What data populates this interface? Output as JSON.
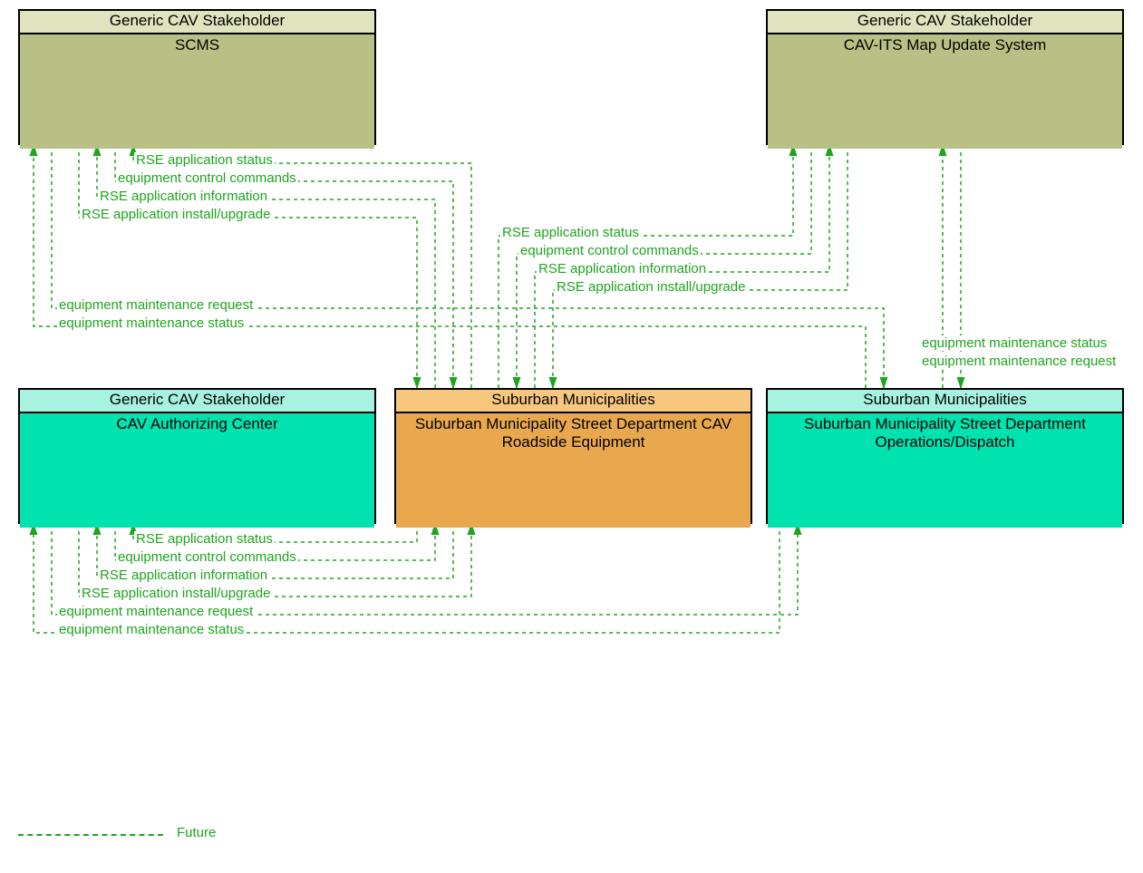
{
  "boxes": {
    "scms": {
      "header": "Generic CAV Stakeholder",
      "title": "SCMS"
    },
    "mapupdate": {
      "header": "Generic CAV Stakeholder",
      "title": "CAV-ITS Map Update System"
    },
    "authcenter": {
      "header": "Generic CAV Stakeholder",
      "title": "CAV Authorizing Center"
    },
    "roadside": {
      "header": "Suburban Municipalities",
      "title": "Suburban Municipality Street Department CAV Roadside Equipment"
    },
    "dispatch": {
      "header": "Suburban Municipalities",
      "title": "Suburban Municipality Street Department Operations/Dispatch"
    }
  },
  "flows": {
    "set1": {
      "a": "RSE application status",
      "b": "equipment control commands",
      "c": "RSE application information",
      "d": "RSE application install/upgrade",
      "e": "equipment maintenance request",
      "f": "equipment maintenance status"
    },
    "set2": {
      "a": "RSE application status",
      "b": "equipment control commands",
      "c": "RSE application information",
      "d": "RSE application install/upgrade",
      "e": "equipment maintenance status",
      "f": "equipment maintenance request"
    },
    "set3": {
      "a": "RSE application status",
      "b": "equipment control commands",
      "c": "RSE application information",
      "d": "RSE application install/upgrade",
      "e": "equipment maintenance request",
      "f": "equipment maintenance status"
    }
  },
  "legend": "Future",
  "chart_data": {
    "type": "diagram",
    "nodes": [
      {
        "id": "scms",
        "stakeholder": "Generic CAV Stakeholder",
        "name": "SCMS",
        "color": "olive"
      },
      {
        "id": "mapupdate",
        "stakeholder": "Generic CAV Stakeholder",
        "name": "CAV-ITS Map Update System",
        "color": "olive"
      },
      {
        "id": "authcenter",
        "stakeholder": "Generic CAV Stakeholder",
        "name": "CAV Authorizing Center",
        "color": "teal"
      },
      {
        "id": "roadside",
        "stakeholder": "Suburban Municipalities",
        "name": "Suburban Municipality Street Department CAV Roadside Equipment",
        "color": "orange"
      },
      {
        "id": "dispatch",
        "stakeholder": "Suburban Municipalities",
        "name": "Suburban Municipality Street Department Operations/Dispatch",
        "color": "teal"
      }
    ],
    "edges": [
      {
        "from": "roadside",
        "to": "scms",
        "label": "RSE application status",
        "status": "Future"
      },
      {
        "from": "scms",
        "to": "roadside",
        "label": "equipment control commands",
        "status": "Future"
      },
      {
        "from": "roadside",
        "to": "scms",
        "label": "RSE application information",
        "status": "Future"
      },
      {
        "from": "scms",
        "to": "roadside",
        "label": "RSE application install/upgrade",
        "status": "Future"
      },
      {
        "from": "scms",
        "to": "dispatch",
        "label": "equipment maintenance request",
        "status": "Future"
      },
      {
        "from": "dispatch",
        "to": "scms",
        "label": "equipment maintenance status",
        "status": "Future"
      },
      {
        "from": "roadside",
        "to": "mapupdate",
        "label": "RSE application status",
        "status": "Future"
      },
      {
        "from": "mapupdate",
        "to": "roadside",
        "label": "equipment control commands",
        "status": "Future"
      },
      {
        "from": "roadside",
        "to": "mapupdate",
        "label": "RSE application information",
        "status": "Future"
      },
      {
        "from": "mapupdate",
        "to": "roadside",
        "label": "RSE application install/upgrade",
        "status": "Future"
      },
      {
        "from": "dispatch",
        "to": "mapupdate",
        "label": "equipment maintenance status",
        "status": "Future"
      },
      {
        "from": "mapupdate",
        "to": "dispatch",
        "label": "equipment maintenance request",
        "status": "Future"
      },
      {
        "from": "roadside",
        "to": "authcenter",
        "label": "RSE application status",
        "status": "Future"
      },
      {
        "from": "authcenter",
        "to": "roadside",
        "label": "equipment control commands",
        "status": "Future"
      },
      {
        "from": "roadside",
        "to": "authcenter",
        "label": "RSE application information",
        "status": "Future"
      },
      {
        "from": "authcenter",
        "to": "roadside",
        "label": "RSE application install/upgrade",
        "status": "Future"
      },
      {
        "from": "authcenter",
        "to": "dispatch",
        "label": "equipment maintenance request",
        "status": "Future"
      },
      {
        "from": "dispatch",
        "to": "authcenter",
        "label": "equipment maintenance status",
        "status": "Future"
      }
    ],
    "legend": [
      {
        "style": "dashed-green",
        "label": "Future"
      }
    ]
  }
}
